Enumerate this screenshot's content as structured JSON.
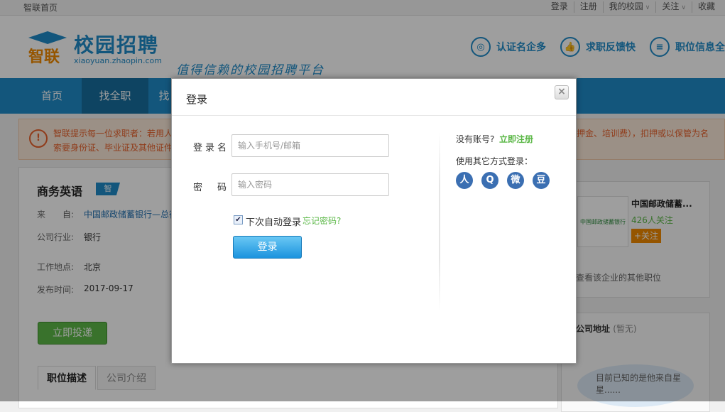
{
  "topbar": {
    "home": "智联首页",
    "links": [
      "登录",
      "注册",
      "我的校园",
      "关注",
      "收藏"
    ]
  },
  "header": {
    "logo_icon_chars": "智联",
    "logo_cn": "校园招聘",
    "logo_en": "xiaoyuan.zhaopin.com",
    "slogan": "值得信赖的校园招聘平台",
    "features": [
      {
        "label": "认证名企多",
        "icon": "medal-icon"
      },
      {
        "label": "求职反馈快",
        "icon": "thumbs-up-icon"
      },
      {
        "label": "职位信息全",
        "icon": "list-icon"
      }
    ]
  },
  "nav": {
    "items": [
      "首页",
      "找全职",
      "找"
    ]
  },
  "notice": {
    "line1": "智联提示每一位求职者：若用人",
    "line1_right": "押金、培训费），扣押或以保管为名",
    "line2": "索要身份证、毕业证及其他证件"
  },
  "job": {
    "title": "商务英语",
    "badge": "智",
    "from_label": "来　　自:",
    "from_value": "中国邮政储蓄银行—总行",
    "industry_label": "公司行业:",
    "industry_value": "银行",
    "location_label": "工作地点:",
    "location_value": "北京",
    "date_label": "发布时间:",
    "date_value": "2017-09-17",
    "apply_button": "立即投递",
    "tabs": [
      "职位描述",
      "公司介绍"
    ]
  },
  "company": {
    "name": "中国邮政储蓄...",
    "follow": "426人关注",
    "follow_button": "+关注",
    "more": "查看该企业的其他职位",
    "logo_text": "中国邮政储蓄银行"
  },
  "address": {
    "heading": "公司地址",
    "heading_note": "(暂无)",
    "bubble": "目前已知的是他来自星星......"
  },
  "modal": {
    "title": "登录",
    "close": "×",
    "username_label": "登录名",
    "username_placeholder": "输入手机号/邮箱",
    "password_label": "密　码",
    "password_placeholder": "输入密码",
    "remember_checked": true,
    "remember_label": "下次自动登录",
    "forgot_link": "忘记密码?",
    "login_button": "登录",
    "no_account": "没有账号?",
    "register_link": "立即注册",
    "other_methods": "使用其它方式登录：",
    "socials": [
      {
        "name": "renren-icon",
        "glyph": "人"
      },
      {
        "name": "qq-icon",
        "glyph": "Q"
      },
      {
        "name": "weibo-icon",
        "glyph": "微"
      },
      {
        "name": "douban-icon",
        "glyph": "豆"
      }
    ]
  }
}
